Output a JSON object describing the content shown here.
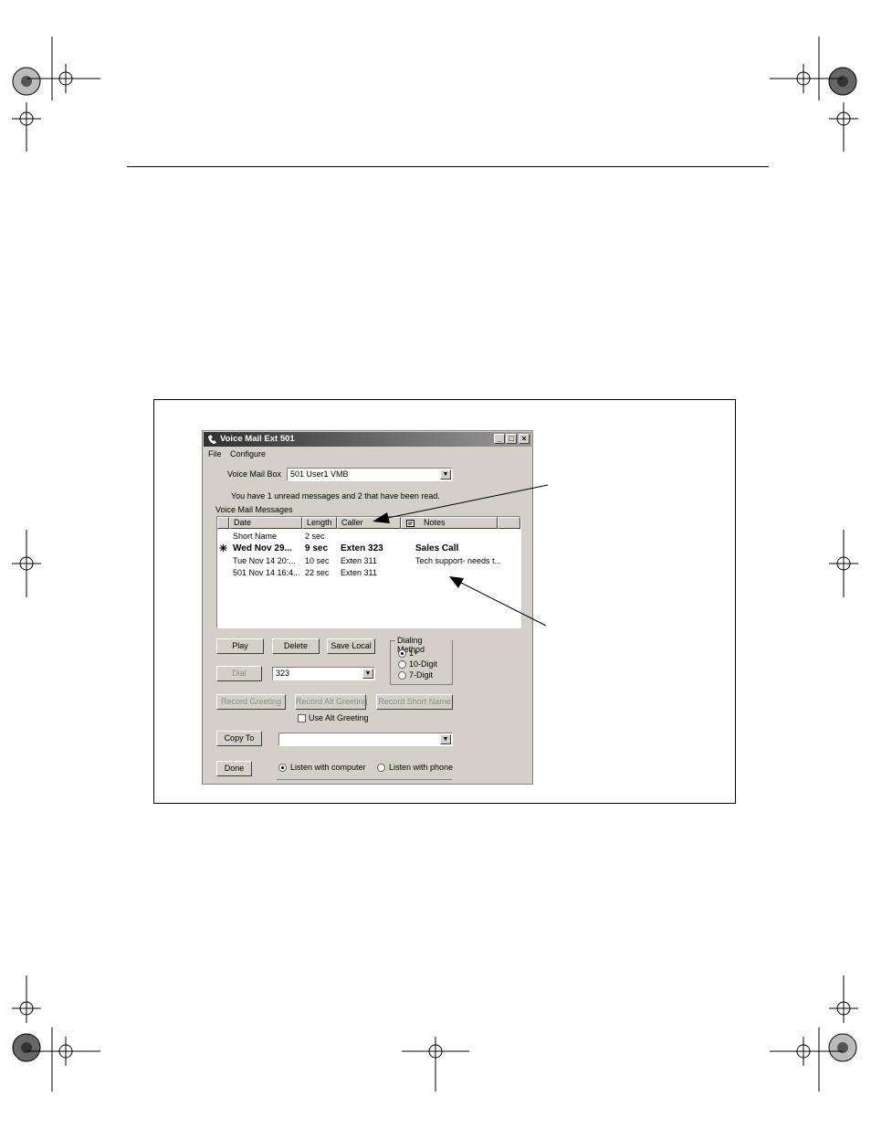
{
  "window": {
    "title": "Voice Mail Ext 501",
    "minimize": "_",
    "maximize": "□",
    "close": "×"
  },
  "menu": {
    "file": "File",
    "configure": "Configure"
  },
  "mailbox": {
    "label": "Voice Mail Box",
    "value": "501   User1 VMB"
  },
  "status_text": "You have 1 unread messages and 2 that have been read.",
  "messages_label": "Voice Mail Messages",
  "columns": {
    "date": "Date",
    "length": "Length",
    "caller": "Caller",
    "notes": "Notes"
  },
  "rows": [
    {
      "marker": "",
      "date": "Short Name",
      "length": "2 sec",
      "caller": "",
      "notes": ""
    },
    {
      "marker": "✳",
      "date": "Wed Nov 29...",
      "length": "9 sec",
      "caller": "Exten 323",
      "notes": "Sales Call"
    },
    {
      "marker": "",
      "date": "Tue Nov 14 20:...",
      "length": "10 sec",
      "caller": "Exten 311",
      "notes": "Tech support- needs t..."
    },
    {
      "marker": "",
      "date": "501 Nov 14 16:4...",
      "length": "22 sec",
      "caller": "Exten 311",
      "notes": ""
    }
  ],
  "buttons": {
    "play": "Play",
    "delete": "Delete",
    "save_local": "Save Local",
    "dial": "Dial",
    "record_greeting": "Record Greeting",
    "record_alt_greeting": "Record Alt Greeting",
    "record_short_name": "Record Short Name",
    "copy_to": "Copy To",
    "done": "Done"
  },
  "dial_value": "323",
  "dialing_method": {
    "title": "Dialing Method",
    "options": [
      "1+",
      "10-Digit",
      "7-Digit"
    ],
    "selected": "1+"
  },
  "use_alt_greeting": "Use Alt Greeting",
  "copy_to_value": "",
  "listen": {
    "computer": "Listen with computer",
    "phone": "Listen with phone",
    "selected": "computer"
  },
  "colors": {
    "window_face": "#d4d0c8",
    "title_dark": "#303030",
    "title_light": "#9a9a9a"
  }
}
